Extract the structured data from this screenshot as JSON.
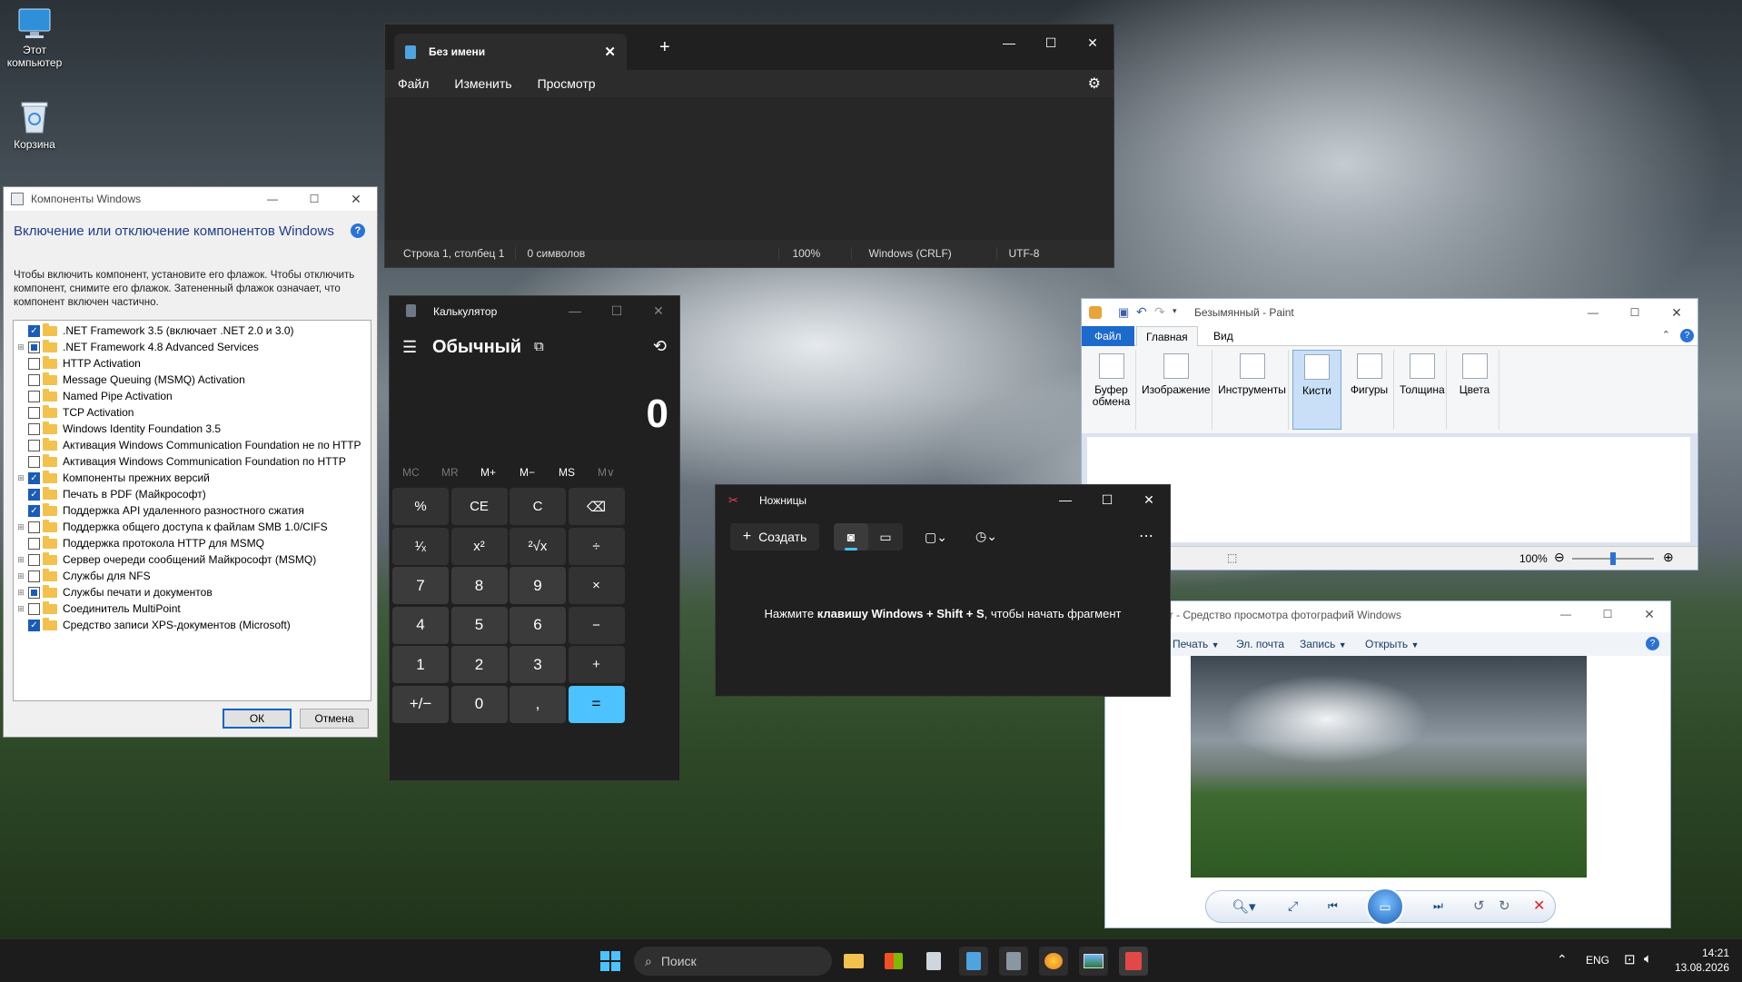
{
  "desktop": {
    "icons": [
      {
        "label": "Этот компьютер",
        "icon": "monitor-icon"
      },
      {
        "label": "Корзина",
        "icon": "recycle-bin-icon"
      }
    ]
  },
  "notepad": {
    "tab_title": "Без имени",
    "menu": [
      "Файл",
      "Изменить",
      "Просмотр"
    ],
    "status": {
      "position": "Строка 1, столбец 1",
      "chars": "0 символов",
      "zoom": "100%",
      "line_endings": "Windows (CRLF)",
      "encoding": "UTF-8"
    }
  },
  "features": {
    "title": "Компоненты Windows",
    "heading": "Включение или отключение компонентов Windows",
    "description": "Чтобы включить компонент, установите его флажок. Чтобы отключить компонент, снимите его флажок. Затененный флажок означает, что компонент включен частично.",
    "items": [
      {
        "label": ".NET Framework 3.5 (включает .NET 2.0 и 3.0)",
        "state": "on",
        "expandable": false
      },
      {
        "label": ".NET Framework 4.8 Advanced Services",
        "state": "partial",
        "expandable": true
      },
      {
        "label": "HTTP Activation",
        "state": "off",
        "expandable": false
      },
      {
        "label": "Message Queuing (MSMQ) Activation",
        "state": "off",
        "expandable": false
      },
      {
        "label": "Named Pipe Activation",
        "state": "off",
        "expandable": false
      },
      {
        "label": "TCP Activation",
        "state": "off",
        "expandable": false
      },
      {
        "label": "Windows Identity Foundation 3.5",
        "state": "off",
        "expandable": false
      },
      {
        "label": "Активация Windows Communication Foundation не по HTTP",
        "state": "off",
        "expandable": false
      },
      {
        "label": "Активация Windows Communication Foundation по HTTP",
        "state": "off",
        "expandable": false
      },
      {
        "label": "Компоненты прежних версий",
        "state": "on",
        "expandable": true
      },
      {
        "label": "Печать в PDF (Майкрософт)",
        "state": "on",
        "expandable": false
      },
      {
        "label": "Поддержка API удаленного разностного сжатия",
        "state": "on",
        "expandable": false
      },
      {
        "label": "Поддержка общего доступа к файлам SMB 1.0/CIFS",
        "state": "off",
        "expandable": true
      },
      {
        "label": "Поддержка протокола HTTP для MSMQ",
        "state": "off",
        "expandable": false
      },
      {
        "label": "Сервер очереди сообщений Майкрософт (MSMQ)",
        "state": "off",
        "expandable": true
      },
      {
        "label": "Службы для NFS",
        "state": "off",
        "expandable": true
      },
      {
        "label": "Службы печати и документов",
        "state": "partial",
        "expandable": true
      },
      {
        "label": "Соединитель MultiPoint",
        "state": "off",
        "expandable": true
      },
      {
        "label": "Средство записи XPS-документов (Microsoft)",
        "state": "on",
        "expandable": false
      }
    ],
    "ok": "ОК",
    "cancel": "Отмена"
  },
  "calculator": {
    "title": "Калькулятор",
    "mode": "Обычный",
    "display": "0",
    "memory": [
      "MC",
      "MR",
      "M+",
      "M−",
      "MS",
      "M∨"
    ],
    "keys": [
      [
        "%",
        "CE",
        "C",
        "⌫"
      ],
      [
        "¹⁄ₓ",
        "x²",
        "²√x",
        "÷"
      ],
      [
        "7",
        "8",
        "9",
        "×"
      ],
      [
        "4",
        "5",
        "6",
        "−"
      ],
      [
        "1",
        "2",
        "3",
        "+"
      ],
      [
        "+/−",
        "0",
        ",",
        "="
      ]
    ]
  },
  "paint": {
    "title": "Безымянный - Paint",
    "tabs": [
      "Файл",
      "Главная",
      "Вид"
    ],
    "groups": [
      "Буфер обмена",
      "Изображение",
      "Инструменты",
      "Кисти",
      "Фигуры",
      "Толщина",
      "Цвета"
    ],
    "zoom": "100%"
  },
  "snipping": {
    "title": "Ножницы",
    "new_button": "Создать",
    "hint_pre": "Нажмите ",
    "hint_keys": "клавишу Windows + Shift + S",
    "hint_post": ", чтобы начать фрагмент"
  },
  "photo_viewer": {
    "title": "er - Средство просмотра фотографий Windows",
    "menu": [
      "Печать",
      "Эл. почта",
      "Запись",
      "Открыть"
    ]
  },
  "taskbar": {
    "search_placeholder": "Поиск",
    "language": "ENG",
    "time": "14:21",
    "date": "13.08.2026"
  }
}
